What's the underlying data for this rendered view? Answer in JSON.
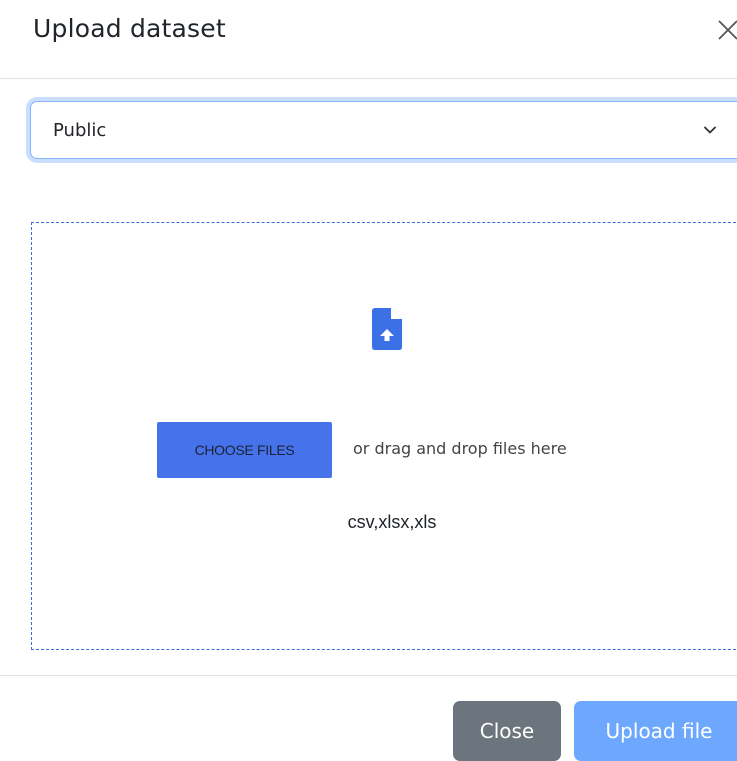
{
  "modal": {
    "title": "Upload dataset",
    "close_icon": "close-icon"
  },
  "visibility_select": {
    "selected": "Public",
    "icon": "chevron-down-icon"
  },
  "dropzone": {
    "icon": "file-upload-icon",
    "choose_label": "CHOOSE FILES",
    "drag_text": "or drag and drop files here",
    "formats": "csv,xlsx,xls"
  },
  "footer": {
    "close_label": "Close",
    "upload_label": "Upload file"
  },
  "colors": {
    "accent": "#4673ec",
    "upload_button": "#6ea8fe",
    "close_button": "#6c757d"
  }
}
